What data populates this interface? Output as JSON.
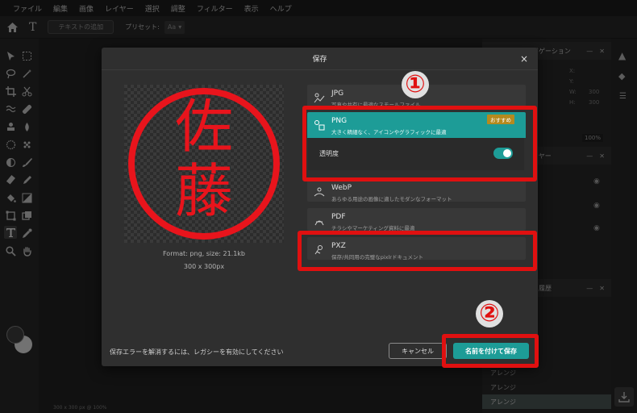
{
  "menubar": {
    "items": [
      "ファイル",
      "編集",
      "画像",
      "レイヤー",
      "選択",
      "調整",
      "フィルター",
      "表示",
      "ヘルプ"
    ]
  },
  "optionsbar": {
    "text_add_label": "テキストの追加",
    "preset_label": "プリセット:",
    "preset_value": "Aa"
  },
  "right_panel": {
    "navigator_title": "ナビゲーション",
    "nav_labels": [
      "X:",
      "Y:",
      "W:",
      "H:"
    ],
    "nav_values": [
      "",
      "",
      "300",
      "300"
    ],
    "zoom_value": "100%",
    "layers_title": "レイヤー",
    "history_title": "履歴",
    "history_items": [
      "アレンジ",
      "アレンジ",
      "アレンジ"
    ]
  },
  "canvas_status": "300 x 300 px @ 100%",
  "dialog": {
    "title": "保存",
    "close_label": "×",
    "preview": {
      "stamp_text_top": "佐",
      "stamp_text_bottom": "藤",
      "format_info": "Format: png, size: 21.1kb",
      "dimensions": "300 x 300px"
    },
    "formats": [
      {
        "name": "JPG",
        "desc": "写真や共有に最適なスモールファイル"
      },
      {
        "name": "PNG",
        "desc": "大きく精細なく、アイコンやグラフィックに最適",
        "badge": "おすすめ"
      },
      {
        "name": "WebP",
        "desc": "あらゆる用途の画像に適したモダンなフォーマット"
      },
      {
        "name": "PDF",
        "desc": "チラシやマーケティング資料に最適"
      },
      {
        "name": "PXZ",
        "desc": "保存/共同用の完璧なpixlrドキュメント"
      }
    ],
    "transparency_label": "透明度",
    "transparency_on": true,
    "footer_message": "保存エラーを解消するには、レガシーを有効にしてください",
    "cancel_label": "キャンセル",
    "save_label": "名前を付けて保存"
  },
  "annotations": {
    "marker_1": "①",
    "marker_2": "②",
    "color": "#e01010"
  },
  "colors": {
    "accent": "#1d9c97",
    "stamp_red": "#e8141c",
    "badge": "#b58a1e"
  }
}
